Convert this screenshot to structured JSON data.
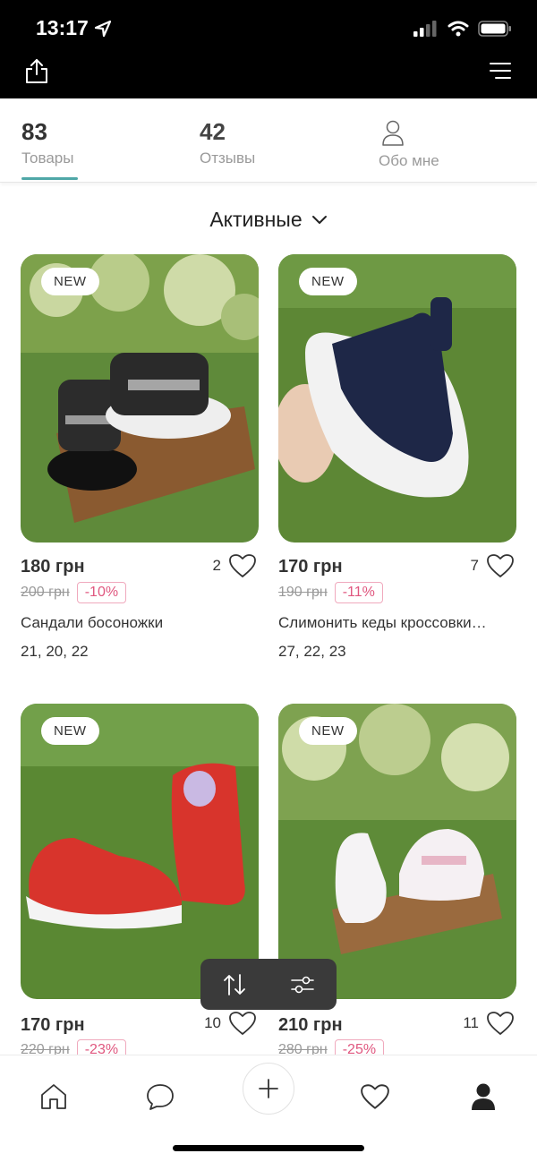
{
  "status_bar": {
    "time": "13:17"
  },
  "profile_stats": [
    {
      "count": "83",
      "label": "Товары"
    },
    {
      "count": "42",
      "label": "Отзывы"
    },
    {
      "label": "Обо мне"
    }
  ],
  "filter": {
    "label": "Активные"
  },
  "products": [
    {
      "badge": "NEW",
      "price": "180 грн",
      "likes": "2",
      "old_price": "200 грн",
      "discount": "-10%",
      "title": "Сандали босоножки",
      "sizes": "21, 20, 22"
    },
    {
      "badge": "NEW",
      "price": "170 грн",
      "likes": "7",
      "old_price": "190 грн",
      "discount": "-11%",
      "title": "Слимонить кеды кроссовки…",
      "sizes": "27, 22, 23"
    },
    {
      "badge": "NEW",
      "price": "170 грн",
      "likes": "10",
      "old_price": "220 грн",
      "discount": "-23%"
    },
    {
      "badge": "NEW",
      "price": "210 грн",
      "likes": "11",
      "old_price": "280 грн",
      "discount": "-25%"
    }
  ],
  "colors": {
    "accent": "#4fa7a7",
    "discount": "#e0577f"
  }
}
